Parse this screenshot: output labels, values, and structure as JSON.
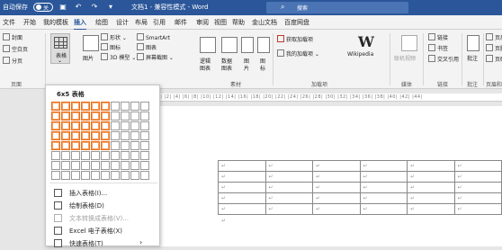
{
  "titlebar": {
    "autosave_label": "自动保存",
    "autosave_state": "关",
    "document_title": "文档1 - 兼容性模式 - Word",
    "search_placeholder": "搜索"
  },
  "tabs": [
    {
      "label": "文件"
    },
    {
      "label": "开始"
    },
    {
      "label": "我的模板"
    },
    {
      "label": "插入",
      "active": true
    },
    {
      "label": "绘图"
    },
    {
      "label": "设计"
    },
    {
      "label": "布局"
    },
    {
      "label": "引用"
    },
    {
      "label": "邮件"
    },
    {
      "label": "审阅"
    },
    {
      "label": "视图"
    },
    {
      "label": "帮助"
    },
    {
      "label": "金山文档"
    },
    {
      "label": "百度网盘"
    }
  ],
  "ribbon": {
    "pages": {
      "cover": "封面",
      "blank": "空白页",
      "break": "分页",
      "group": "页面"
    },
    "table": {
      "label": "表格",
      "group": "表格"
    },
    "illustrations": {
      "picture": "图片",
      "shapes": "形状",
      "icons": "图标",
      "model3d": "3D 模型",
      "smartart": "SmartArt",
      "chart": "图表",
      "screenshot": "屏幕截图"
    },
    "material": {
      "logic": "逻辑",
      "logic2": "图表",
      "data": "数据",
      "data2": "图表",
      "pic": "图",
      "pic2": "片",
      "pic3": "图",
      "pic4": "标",
      "group": "素材"
    },
    "addins": {
      "get": "获取加载项",
      "mine": "我的加载项",
      "wikipedia": "Wikipedia",
      "group": "加载项"
    },
    "media": {
      "video": "联机视频",
      "group": "媒体"
    },
    "links": {
      "link": "链接",
      "bookmark": "书签",
      "crossref": "交叉引用",
      "group": "链接"
    },
    "comments": {
      "comment": "批注",
      "group": "批注"
    },
    "header_footer": {
      "header": "页眉",
      "footer": "页脚",
      "pagenum": "页码",
      "group": "页眉和页"
    }
  },
  "ruler_text": "|4| |2| | |2| |4| |6| |8| |10| |12| |14| |16| |18| |20| |22| |24| |26| |28| |30| |32| |34| |36| |38| |40| |42| |44|",
  "dropdown": {
    "grid_header": "6x5 表格",
    "grid_cols": 10,
    "grid_rows": 8,
    "selected_cols": 6,
    "selected_rows": 5,
    "items": [
      {
        "label": "插入表格(I)...",
        "icon": "insert-table-icon",
        "disabled": false
      },
      {
        "label": "绘制表格(D)",
        "icon": "draw-table-icon",
        "disabled": false
      },
      {
        "label": "文本转换成表格(V)...",
        "icon": "convert-text-icon",
        "disabled": true
      },
      {
        "label": "Excel 电子表格(X)",
        "icon": "excel-icon",
        "disabled": false
      },
      {
        "label": "快速表格(T)",
        "icon": "quick-table-icon",
        "disabled": false,
        "submenu": true
      }
    ]
  },
  "document": {
    "rows": 5,
    "cols": 6,
    "cell_mark": "↵",
    "paragraph_mark": "↵"
  },
  "colors": {
    "accent": "#2b579a",
    "grid_highlight": "#e86f1c"
  }
}
